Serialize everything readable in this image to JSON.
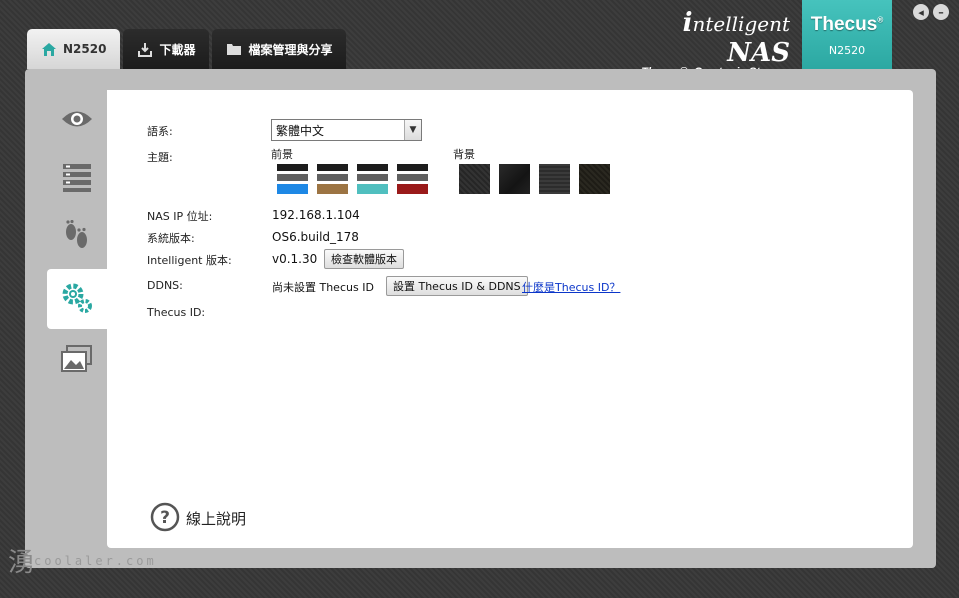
{
  "tabs": [
    {
      "label": "N2520",
      "icon": "home-icon",
      "active": true
    },
    {
      "label": "下載器",
      "icon": "download-icon",
      "active": false
    },
    {
      "label": "檔案管理與分享",
      "icon": "folder-icon",
      "active": false
    }
  ],
  "brand": {
    "title_i": "i",
    "title_rest": "ntelligent",
    "title_nas": "NAS",
    "tagline": "Thecus®, Creator in Storage",
    "badge_name": "Thecus",
    "badge_reg": "®",
    "badge_model": "N2520"
  },
  "window_controls": {
    "back": "back-icon",
    "minimize": "minimize-icon"
  },
  "sidebar": [
    {
      "name": "eye-icon",
      "active": false
    },
    {
      "name": "list-icon",
      "active": false
    },
    {
      "name": "footprints-icon",
      "active": false
    },
    {
      "name": "gears-icon",
      "active": true
    },
    {
      "name": "windows-icon",
      "active": false
    }
  ],
  "settings": {
    "language_label": "語系:",
    "language_value": "繁體中文",
    "theme_label": "主題:",
    "foreground_label": "前景",
    "background_label": "背景",
    "foreground_swatches": [
      "#1e88e5",
      "#9c7443",
      "#50bfbf",
      "#9a1a1a"
    ],
    "background_swatch_count": 4,
    "nas_ip_label": "NAS IP 位址:",
    "nas_ip_value": "192.168.1.104",
    "system_version_label": "系統版本:",
    "system_version_value": "OS6.build_178",
    "intelligent_version_label": "Intelligent 版本:",
    "intelligent_version_value": "v0.1.30",
    "check_version_button": "檢查軟體版本",
    "ddns_label": "DDNS:",
    "ddns_status": "尚未設置 Thecus ID",
    "ddns_button": "設置 Thecus ID & DDNS",
    "ddns_link": "什麼是Thecus ID？",
    "thecus_id_label": "Thecus ID:"
  },
  "help": {
    "label": "線上說明"
  },
  "watermark": {
    "glyph": "湧",
    "text": "coolaler.com"
  },
  "colors": {
    "accent": "#2aa8a2",
    "link": "#0b36c9"
  }
}
